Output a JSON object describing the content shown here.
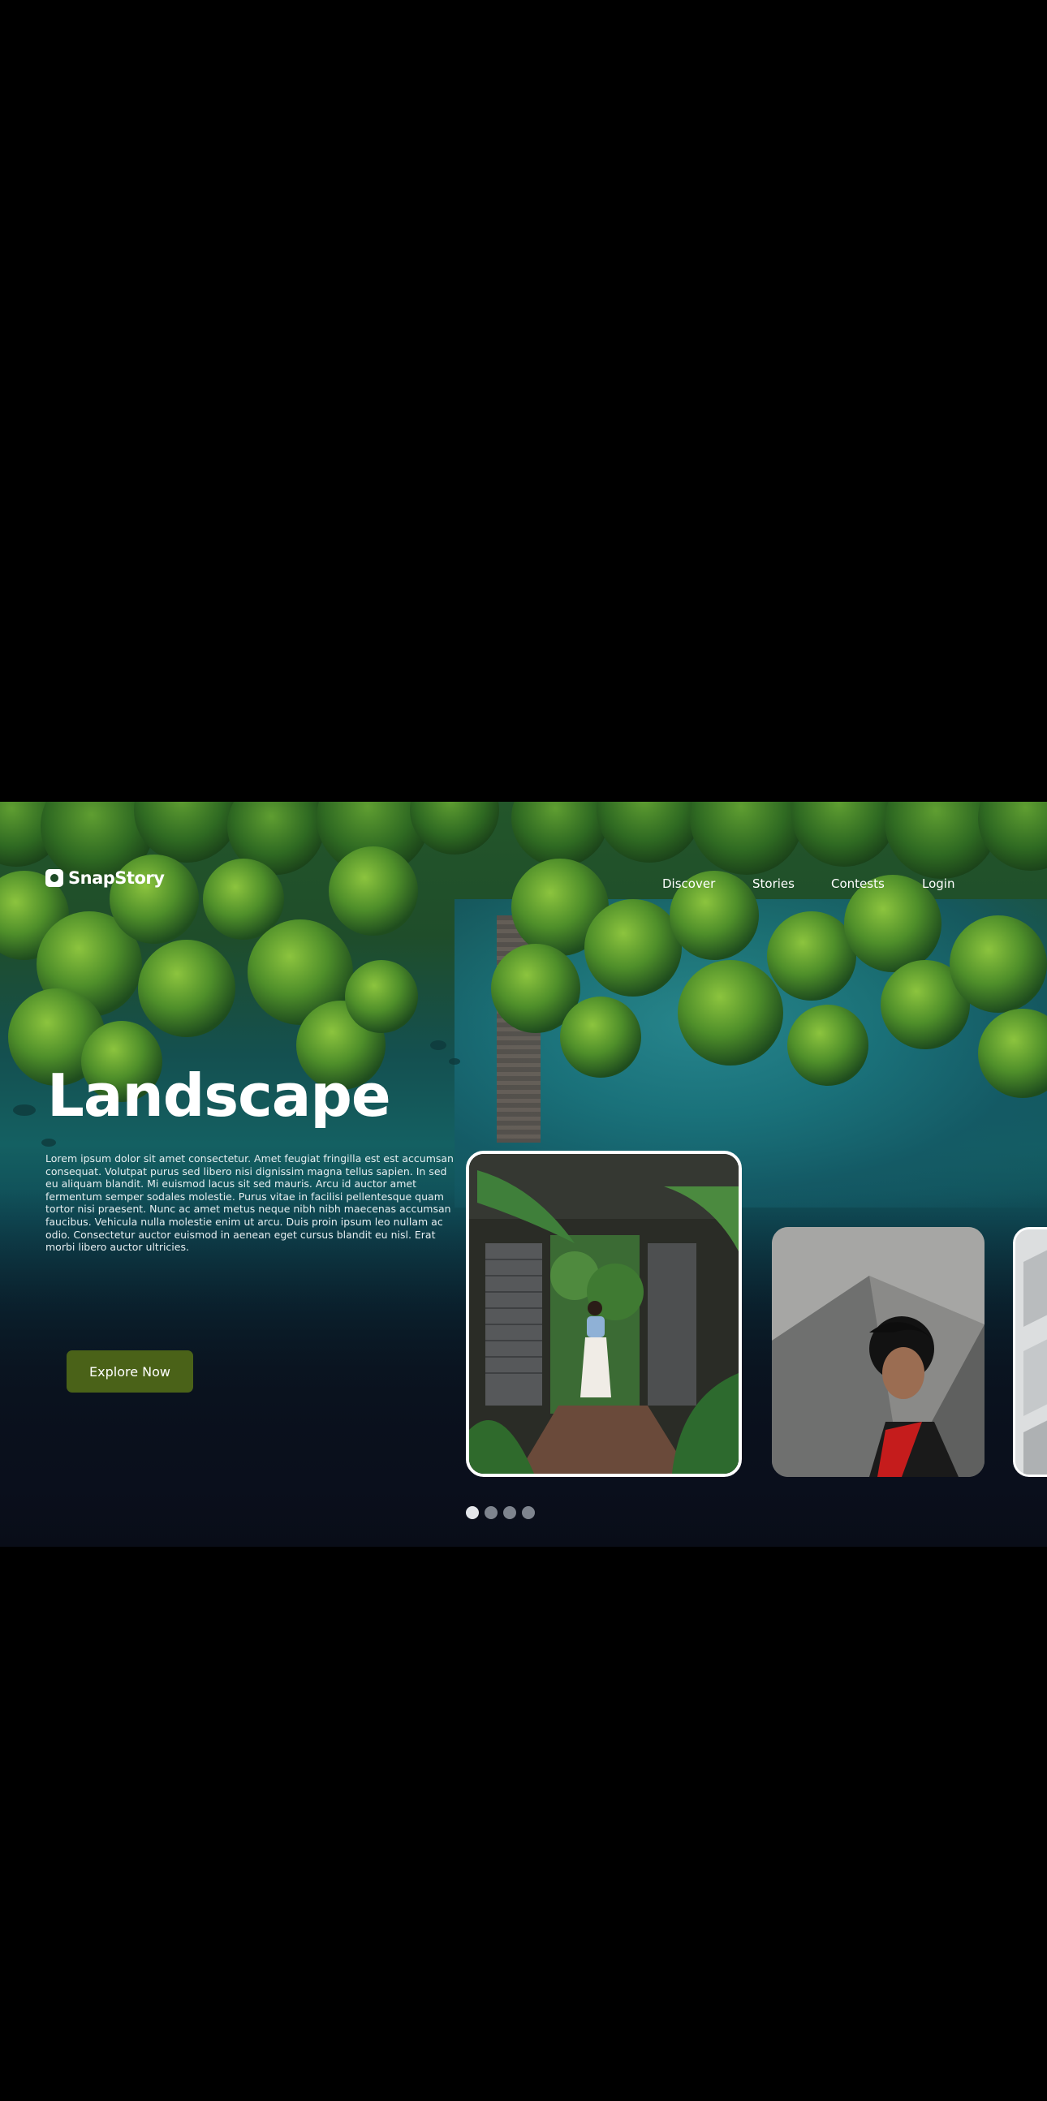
{
  "brand": {
    "name": "SnapStory"
  },
  "nav": {
    "items": [
      {
        "label": "Discover"
      },
      {
        "label": "Stories"
      },
      {
        "label": "Contests"
      },
      {
        "label": "Login"
      }
    ]
  },
  "hero": {
    "title": "Landscape",
    "description": "Lorem ipsum dolor sit amet consectetur. Amet feugiat fringilla est est accumsan consequat. Volutpat purus sed libero nisi dignissim magna tellus sapien. In sed eu aliquam blandit. Mi euismod lacus sit sed mauris. Arcu id auctor amet fermentum semper sodales molestie. Purus vitae in facilisi pellentesque quam tortor nisi praesent. Nunc ac amet metus neque nibh nibh maecenas accumsan faucibus. Vehicula nulla molestie enim ut arcu. Duis proin ipsum leo nullam ac odio. Consectetur auctor euismod in aenean eget cursus blandit eu nisl. Erat morbi libero auctor ultricies.",
    "cta_label": "Explore Now"
  },
  "carousel": {
    "cards": [
      {
        "subject": "woman walking through tropical garden doorway",
        "active": true
      },
      {
        "subject": "portrait of person with red scarf against concrete",
        "active": false
      },
      {
        "subject": "geometric concrete architecture",
        "active": false
      }
    ],
    "pages": 4,
    "current_page": 1
  },
  "colors": {
    "cta": "#4a6218",
    "dot_active": "#e4e6ea",
    "dot_inactive": "#7e848e"
  }
}
